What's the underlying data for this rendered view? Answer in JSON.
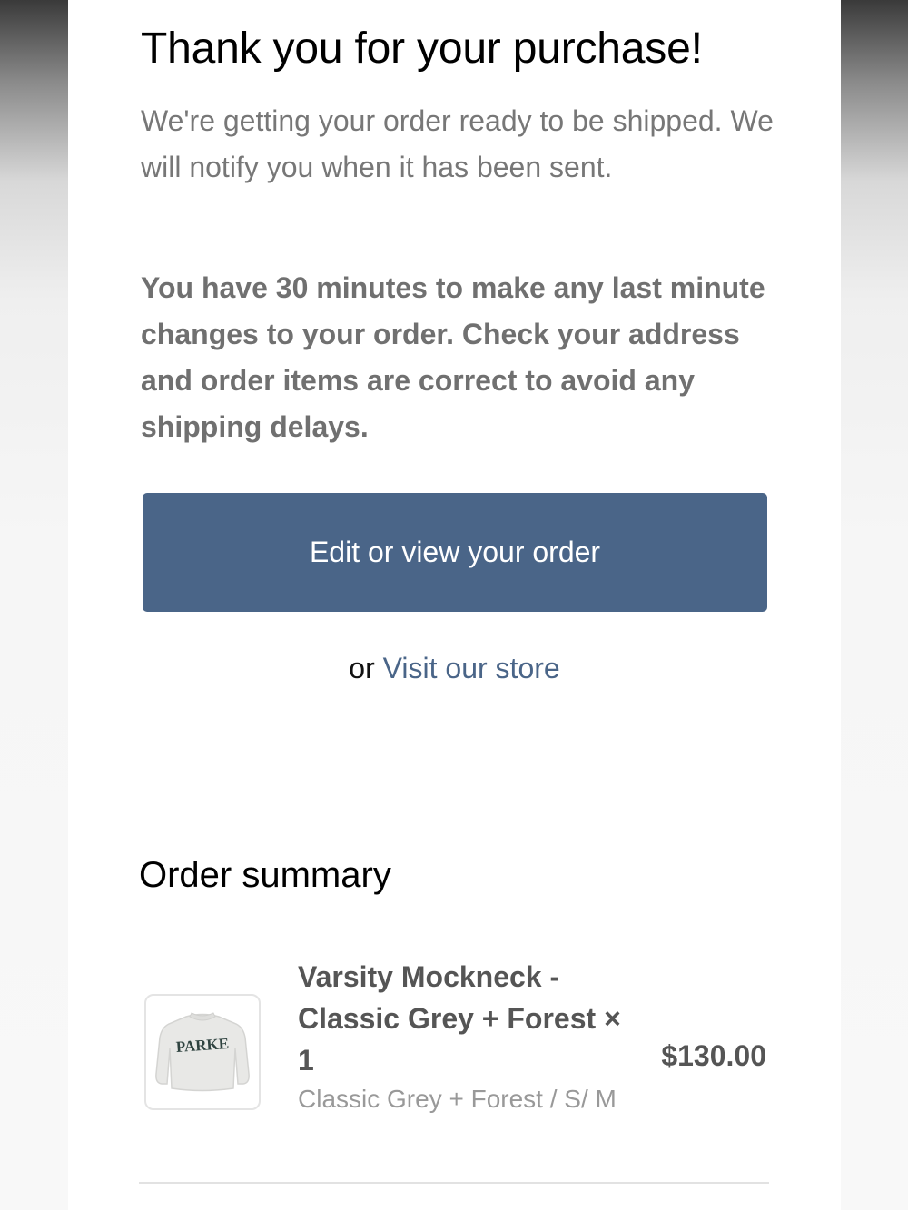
{
  "header": {
    "title": "Thank you for your purchase!",
    "intro": "We're getting your order ready to be shipped. We will notify you when it has been sent.",
    "notice": "You have 30 minutes to make any last minute changes to your order. Check your address and order items are correct to avoid any shipping delays."
  },
  "actions": {
    "edit_order_label": "Edit or view your order",
    "or_text": "or",
    "visit_store_label": "Visit our store"
  },
  "summary": {
    "title": "Order summary",
    "items": [
      {
        "name": "Varsity Mockneck - Classic Grey + Forest × 1",
        "variant": "Classic Grey + Forest / S/ M",
        "price": "$130.00",
        "image_text": "PARKE",
        "image_icon": "sweatshirt-icon"
      }
    ]
  },
  "colors": {
    "button": "#4a6588",
    "link": "#4a6588",
    "muted_text": "#777777"
  }
}
